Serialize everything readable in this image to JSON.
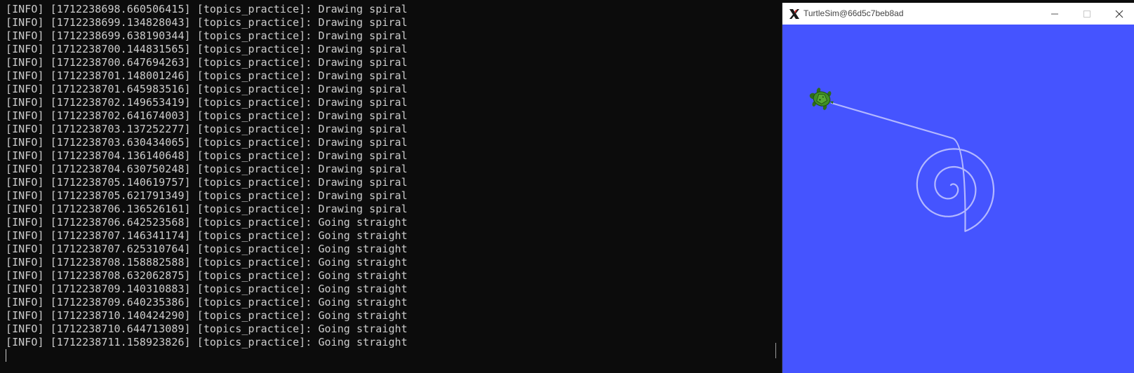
{
  "terminal": {
    "log_lines": [
      "[INFO] [1712238698.660506415] [topics_practice]: Drawing spiral",
      "[INFO] [1712238699.134828043] [topics_practice]: Drawing spiral",
      "[INFO] [1712238699.638190344] [topics_practice]: Drawing spiral",
      "[INFO] [1712238700.144831565] [topics_practice]: Drawing spiral",
      "[INFO] [1712238700.647694263] [topics_practice]: Drawing spiral",
      "[INFO] [1712238701.148001246] [topics_practice]: Drawing spiral",
      "[INFO] [1712238701.645983516] [topics_practice]: Drawing spiral",
      "[INFO] [1712238702.149653419] [topics_practice]: Drawing spiral",
      "[INFO] [1712238702.641674003] [topics_practice]: Drawing spiral",
      "[INFO] [1712238703.137252277] [topics_practice]: Drawing spiral",
      "[INFO] [1712238703.630434065] [topics_practice]: Drawing spiral",
      "[INFO] [1712238704.136140648] [topics_practice]: Drawing spiral",
      "[INFO] [1712238704.630750248] [topics_practice]: Drawing spiral",
      "[INFO] [1712238705.140619757] [topics_practice]: Drawing spiral",
      "[INFO] [1712238705.621791349] [topics_practice]: Drawing spiral",
      "[INFO] [1712238706.136526161] [topics_practice]: Drawing spiral",
      "[INFO] [1712238706.642523568] [topics_practice]: Going straight",
      "[INFO] [1712238707.146341174] [topics_practice]: Going straight",
      "[INFO] [1712238707.625310764] [topics_practice]: Going straight",
      "[INFO] [1712238708.158882588] [topics_practice]: Going straight",
      "[INFO] [1712238708.632062875] [topics_practice]: Going straight",
      "[INFO] [1712238709.140310883] [topics_practice]: Going straight",
      "[INFO] [1712238709.640235386] [topics_practice]: Going straight",
      "[INFO] [1712238710.140424290] [topics_practice]: Going straight",
      "[INFO] [1712238710.644713089] [topics_practice]: Going straight",
      "[INFO] [1712238711.158923826] [topics_practice]: Going straight"
    ],
    "text_color": "#cccccc",
    "background_color": "#0c0c0c"
  },
  "turtlesim": {
    "window_title": "TurtleSim@66d5c7beb8ad",
    "app_icon": "x-window-system-icon",
    "controls": {
      "minimize_icon": "minimize-icon",
      "maximize_icon": "maximize-icon",
      "close_icon": "close-icon"
    },
    "canvas_color": "#4554ff",
    "path_color": "#b3b8ff",
    "turtle_icon": "turtle-icon"
  }
}
